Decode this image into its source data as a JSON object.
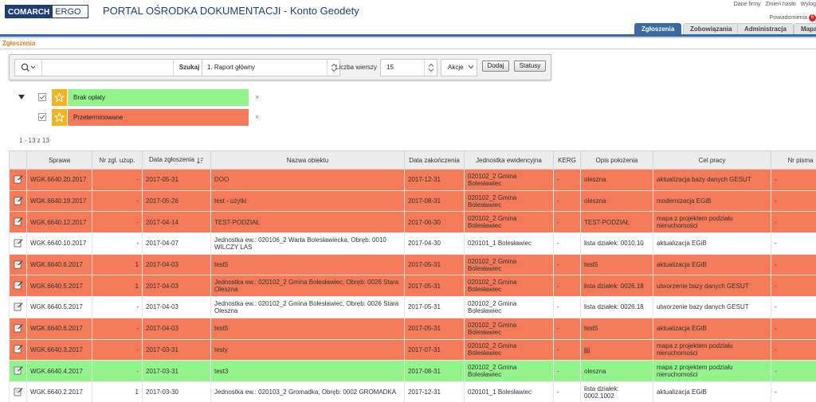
{
  "header": {
    "logo_left": "COMARCH",
    "logo_right": "ERGO",
    "title": "PORTAL OŚRODKA DOKUMENTACJI - Konto Geodety",
    "links": [
      "Dane firmy",
      "Zmień hasło",
      "Wylog"
    ],
    "notifications_label": "Powiadomienia",
    "notification_badge": "6"
  },
  "tabs": [
    {
      "label": "Zgłoszenia",
      "active": true
    },
    {
      "label": "Zobowiązania",
      "active": false
    },
    {
      "label": "Administracja",
      "active": false
    },
    {
      "label": "Mapa",
      "active": false
    }
  ],
  "section_title": "Zgłoszenia",
  "toolbar": {
    "search_placeholder": "",
    "search_button": "Szukaj",
    "report": "1. Raport główny",
    "rows_label": "Liczba wierszy",
    "rows_value": "15",
    "actions": "Akcje",
    "add_button": "Dodaj",
    "status_button": "Statusy"
  },
  "filters": [
    {
      "label": "Brak opłaty",
      "color": "#93f48d",
      "checked": true
    },
    {
      "label": "Przeterminowane",
      "color": "#f47a59",
      "checked": true
    }
  ],
  "count": "1 - 13 z 13",
  "columns": [
    "",
    "Sprawa",
    "Nr zgl. uzup.",
    "Data zgłoszenia",
    "Nazwa obiektu",
    "Data zakończenia",
    "Jednostka ewidencyjna",
    "KERG",
    "Opis położenia",
    "Cel pracy",
    "Nr pisma"
  ],
  "rows": [
    {
      "status": "red",
      "sprawa": "WGK.6640.20.2017",
      "nr": "-",
      "data": "2017-05-31",
      "nazwa": "DOO",
      "zak": "2017-12-31",
      "jedn": "020102_2 Gmina Bolesławiec",
      "kerg": "-",
      "opis": "oleszna",
      "cel": "aktualizacja bazy danych GESUT",
      "pismo": "-"
    },
    {
      "status": "red",
      "sprawa": "WGK.6640.19.2017",
      "nr": "-",
      "data": "2017-05-26",
      "nazwa": "test - użytki",
      "zak": "2017-08-31",
      "jedn": "020102_2 Gmina Bolesławiec",
      "kerg": "-",
      "opis": "oleszna",
      "cel": "modernizacja EGiB",
      "pismo": "-"
    },
    {
      "status": "red",
      "sprawa": "WGK.6640.12.2017",
      "nr": "-",
      "data": "2017-04-14",
      "nazwa": "TEST-PODZIAŁ",
      "zak": "2017-06-30",
      "jedn": "020102_2 Gmina Bolesławiec",
      "kerg": "-",
      "opis": "TEST-PODZIAŁ",
      "cel": "mapa z projektem podziału nieruchomości",
      "pismo": "-"
    },
    {
      "status": "white",
      "sprawa": "WGK.6640.10.2017",
      "nr": "-",
      "data": "2017-04-07",
      "nazwa": "Jednostka ew.: 020106_2 Warta Bolesławiecka, Obręb: 0010 WILCZY LAS",
      "zak": "2017-04-30",
      "jedn": "020101_1 Bolesławiec",
      "kerg": "-",
      "opis": "lista działek: 0010.10",
      "cel": "aktualizacja EGiB",
      "pismo": "-"
    },
    {
      "status": "red",
      "sprawa": "WGK.6640.6.2017",
      "nr": "1",
      "data": "2017-04-03",
      "nazwa": "test5",
      "zak": "2017-05-31",
      "jedn": "020102_2 Gmina Bolesławiec",
      "kerg": "-",
      "opis": "test5",
      "cel": "aktualizacja EGiB",
      "pismo": "-"
    },
    {
      "status": "red",
      "sprawa": "WGK.6640.5.2017",
      "nr": "1",
      "data": "2017-04-03",
      "nazwa": "Jednostka ew.: 020102_2 Gmina Bolesławiec, Obręb: 0026 Stara Oleszna",
      "zak": "2017-05-31",
      "jedn": "020102_2 Gmina Bolesławiec",
      "kerg": "-",
      "opis": "lista działek: 0026.18",
      "cel": "utworzenie bazy danych GESUT",
      "pismo": "-"
    },
    {
      "status": "white",
      "sprawa": "WGK.6640.5.2017",
      "nr": "-",
      "data": "2017-04-03",
      "nazwa": "Jednostka ew.: 020102_2 Gmina Bolesławiec, Obręb: 0026 Stara Oleszna",
      "zak": "2017-05-31",
      "jedn": "020102_2 Gmina Bolesławiec",
      "kerg": "-",
      "opis": "lista działek: 0026.18",
      "cel": "utworzenie bazy danych GESUT",
      "pismo": "-"
    },
    {
      "status": "red",
      "sprawa": "WGK.6640.6.2017",
      "nr": "-",
      "data": "2017-04-03",
      "nazwa": "test5",
      "zak": "2017-05-31",
      "jedn": "020102_2 Gmina Bolesławiec",
      "kerg": "-",
      "opis": "test5",
      "cel": "aktualizacja EGiB",
      "pismo": "-"
    },
    {
      "status": "red",
      "sprawa": "WGK.6640.3.2017",
      "nr": "-",
      "data": "2017-03-31",
      "nazwa": "testy",
      "zak": "2017-07-31",
      "jedn": "020102_2 Gmina Bolesławiec",
      "kerg": "-",
      "opis": "jjjj",
      "cel": "mapa z projektem podziału nieruchomości",
      "pismo": "-"
    },
    {
      "status": "green",
      "sprawa": "WGK.6640.4.2017",
      "nr": "-",
      "data": "2017-03-31",
      "nazwa": "test3",
      "zak": "2017-08-31",
      "jedn": "020102_2 Gmina Bolesławiec",
      "kerg": "-",
      "opis": "oleszna",
      "cel": "mapa z projektem podziału nieruchomości",
      "pismo": "-"
    },
    {
      "status": "white",
      "sprawa": "WGK.6640.2.2017",
      "nr": "1",
      "data": "2017-03-30",
      "nazwa": "Jednostka ew.: 020103_2 Gromadka, Obręb: 0002 GROMADKA",
      "zak": "2017-12-31",
      "jedn": "020101_1 Bolesławiec",
      "kerg": "-",
      "opis": "lista działek: 0002.1002",
      "cel": "aktualizacja EGiB",
      "pismo": "-"
    }
  ]
}
